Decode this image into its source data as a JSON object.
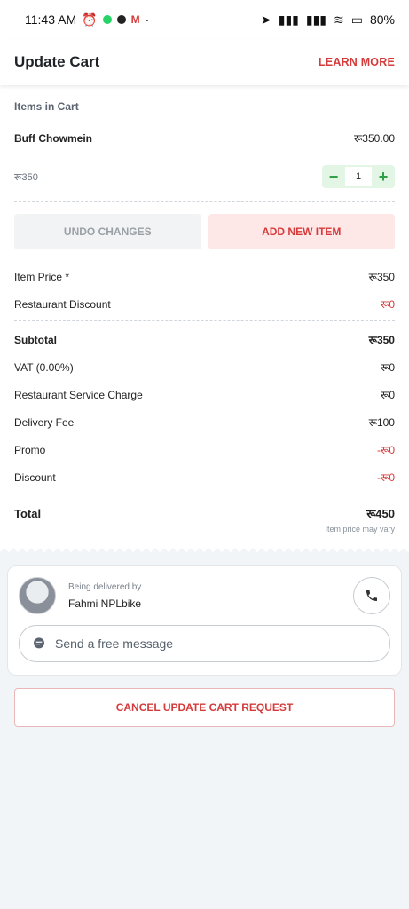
{
  "status": {
    "time": "11:43 AM",
    "battery": "80%"
  },
  "header": {
    "title": "Update Cart",
    "learn_more": "LEARN MORE"
  },
  "cart": {
    "section_label": "Items in Cart",
    "item": {
      "name": "Buff Chowmein",
      "total": "रू350.00",
      "unit_price": "रू350",
      "quantity": "1"
    },
    "buttons": {
      "undo": "UNDO CHANGES",
      "add": "ADD NEW ITEM"
    }
  },
  "summary": {
    "item_price_label": "Item Price *",
    "item_price": "रू350",
    "restaurant_discount_label": "Restaurant Discount",
    "restaurant_discount": "रू0",
    "subtotal_label": "Subtotal",
    "subtotal": "रू350",
    "vat_label": "VAT (0.00%)",
    "vat": "रू0",
    "service_charge_label": "Restaurant Service Charge",
    "service_charge": "रू0",
    "delivery_fee_label": "Delivery Fee",
    "delivery_fee": "रू100",
    "promo_label": "Promo",
    "promo": "-रू0",
    "discount_label": "Discount",
    "discount": "-रू0",
    "total_label": "Total",
    "total": "रू450",
    "note": "Item price may vary"
  },
  "driver": {
    "sub_label": "Being delivered by",
    "name": "Fahmi NPLbike",
    "message_placeholder": "Send a free message"
  },
  "cancel_label": "CANCEL UPDATE CART REQUEST",
  "colors": {
    "accent": "#d63b3b",
    "green": "#2f9e44"
  }
}
